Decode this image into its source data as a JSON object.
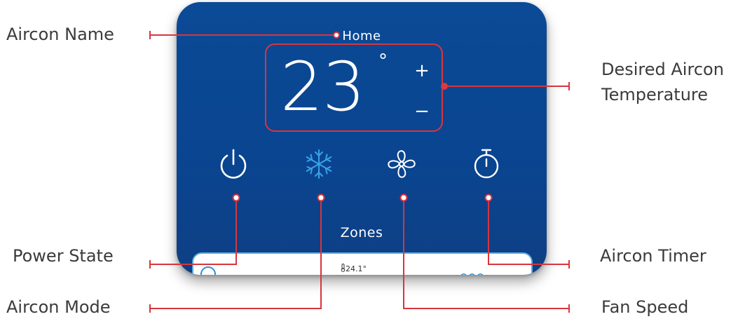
{
  "labels": {
    "aircon_name": "Aircon Name",
    "desired_temp_line1": "Desired Aircon",
    "desired_temp_line2": "Temperature",
    "power_state": "Power State",
    "aircon_mode": "Aircon Mode",
    "aircon_timer": "Aircon Timer",
    "fan_speed": "Fan Speed"
  },
  "panel": {
    "name": "Home",
    "temperature": "23",
    "degree": "°",
    "plus": "+",
    "minus": "−",
    "zones_title": "Zones",
    "zone_temp": "24.1°",
    "zone_more": "ooo"
  },
  "icons": [
    "power-icon",
    "snowflake-icon",
    "fan-icon",
    "stopwatch-icon",
    "thermometer-icon"
  ],
  "colors": {
    "panel_blue": "#0b4a96",
    "callout_red": "#d8353d",
    "mode_active": "#3aa3e8",
    "label_text": "#3b3b3b"
  }
}
